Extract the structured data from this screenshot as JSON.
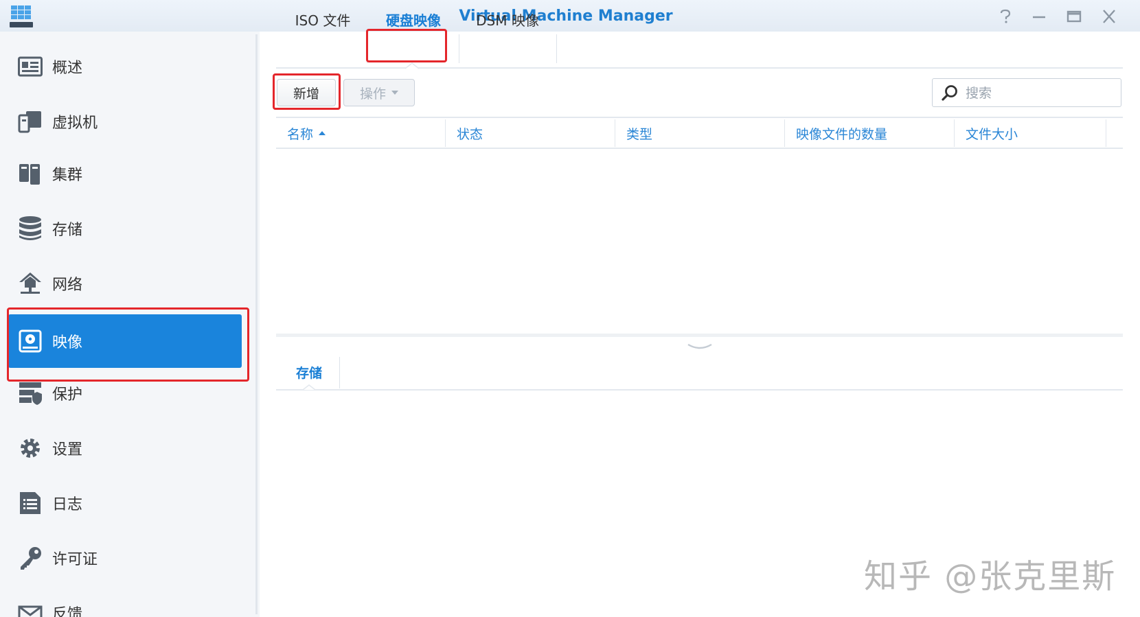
{
  "window": {
    "title": "Virtual Machine Manager",
    "icons": {
      "app": "app-logo",
      "help": "help-icon",
      "minimize": "minimize-icon",
      "maximize": "maximize-icon",
      "close": "close-icon"
    }
  },
  "sidebar": {
    "items": [
      {
        "label": "概述",
        "icon": "overview-icon"
      },
      {
        "label": "虚拟机",
        "icon": "virtual-machine-icon"
      },
      {
        "label": "集群",
        "icon": "cluster-icon"
      },
      {
        "label": "存储",
        "icon": "storage-icon"
      },
      {
        "label": "网络",
        "icon": "network-icon"
      },
      {
        "label": "映像",
        "icon": "image-icon",
        "active": true
      },
      {
        "label": "保护",
        "icon": "protection-icon"
      },
      {
        "label": "设置",
        "icon": "gear-icon"
      },
      {
        "label": "日志",
        "icon": "log-icon"
      },
      {
        "label": "许可证",
        "icon": "key-icon"
      },
      {
        "label": "反馈",
        "icon": "mail-icon"
      }
    ]
  },
  "tabs": [
    {
      "label": "ISO 文件"
    },
    {
      "label": "硬盘映像",
      "selected": true
    },
    {
      "label": "DSM 映像"
    }
  ],
  "toolbar": {
    "add_label": "新增",
    "action_label": "操作",
    "search_placeholder": "搜索"
  },
  "table": {
    "columns": [
      "名称",
      "状态",
      "类型",
      "映像文件的数量",
      "文件大小"
    ],
    "sort_column": "名称",
    "rows": []
  },
  "detail": {
    "tabs": [
      "存储"
    ]
  },
  "watermark": "知乎 @张克里斯",
  "colors": {
    "accent": "#1a84dc",
    "highlight_box": "#e4262b",
    "title": "#1f7fd0"
  }
}
